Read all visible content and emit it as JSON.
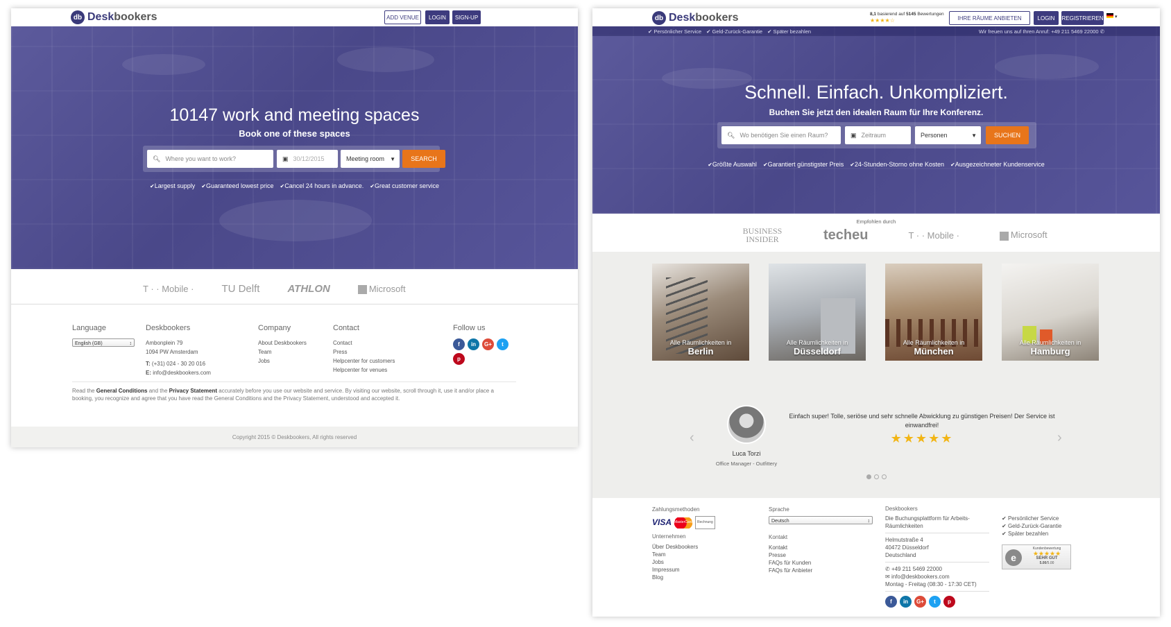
{
  "left": {
    "logo": {
      "mark": "db",
      "desk": "Desk",
      "bookers": "bookers"
    },
    "nav": {
      "add_venue": "ADD VENUE",
      "login": "LOGIN",
      "signup": "SIGN-UP"
    },
    "hero": {
      "title": "10147 work and meeting spaces",
      "subtitle": "Book one of these spaces",
      "search": {
        "where_placeholder": "Where you want to work?",
        "date": "30/12/2015",
        "type": "Meeting room",
        "button": "SEARCH"
      },
      "usps": [
        "Largest supply",
        "Guaranteed lowest price",
        "Cancel 24 hours in advance.",
        "Great customer service"
      ]
    },
    "partners": [
      "T · · Mobile ·",
      "TU Delft",
      "ATHLON",
      "Microsoft"
    ],
    "footer": {
      "language": {
        "heading": "Language",
        "value": "English (GB)"
      },
      "company_info": {
        "heading": "Deskbookers",
        "address1": "Ambonplein 79",
        "address2": "1094 PW Amsterdam",
        "phone_label": "T:",
        "phone": "(+31) 024 - 30 20 016",
        "email_label": "E:",
        "email": "info@deskbookers.com"
      },
      "company": {
        "heading": "Company",
        "links": [
          "About Deskbookers",
          "Team",
          "Jobs"
        ]
      },
      "contact": {
        "heading": "Contact",
        "links": [
          "Contact",
          "Press",
          "Helpcenter for customers",
          "Helpcenter for venues"
        ]
      },
      "follow": {
        "heading": "Follow us"
      },
      "legal": {
        "pre": "Read the ",
        "gc": "General Conditions",
        "mid": " and the ",
        "ps": "Privacy Statement",
        "post": " accurately before you use our website and service. By visiting our website, scroll through it, use it and/or place a booking, you recognize and agree that you have read the General Conditions and the Privacy Statement, understood and accepted it."
      },
      "copyright": "Copyright 2015 © Deskbookers, All rights reserved"
    }
  },
  "right": {
    "logo": {
      "mark": "db",
      "desk": "Desk",
      "bookers": "bookers"
    },
    "rating": {
      "score": "8,1",
      "pre": " basierend auf ",
      "count": "5145",
      "post": " Bewertungen",
      "stars": "★★★★☆"
    },
    "nav": {
      "offer": "IHRE RÄUME ANBIETEN",
      "login": "LOGIN",
      "register": "REGISTRIEREN"
    },
    "topbar": {
      "items": [
        "Persönlicher Service",
        "Geld-Zurück-Garantie",
        "Später bezahlen"
      ],
      "call": "Wir freuen uns auf Ihren Anruf: +49 211 5469 22000"
    },
    "hero": {
      "title": "Schnell. Einfach. Unkompliziert.",
      "subtitle": "Buchen Sie jetzt den idealen Raum für Ihre Konferenz.",
      "search": {
        "where_placeholder": "Wo benötigen Sie einen Raum?",
        "date_placeholder": "Zeitraum",
        "persons": "Personen",
        "button": "SUCHEN"
      },
      "usps": [
        "Größte Auswahl",
        "Garantiert günstigster Preis",
        "24-Stunden-Storno ohne Kosten",
        "Ausgezeichneter Kundenservice"
      ]
    },
    "recommended": {
      "label": "Empfohlen durch",
      "partners": [
        "BUSINESS INSIDER",
        "techeu",
        "T · · Mobile ·",
        "Microsoft"
      ]
    },
    "cities": [
      {
        "pre": "Alle Räumlichkeiten in",
        "name": "Berlin"
      },
      {
        "pre": "Alle Räumlichkeiten in",
        "name": "Düsseldorf"
      },
      {
        "pre": "Alle Räumlichkeiten in",
        "name": "München"
      },
      {
        "pre": "Alle Räumlichkeiten in",
        "name": "Hamburg"
      }
    ],
    "testimonial": {
      "quote": "Einfach super! Tolle, seriöse und sehr schnelle Abwicklung zu günstigen Preisen! Der Service ist einwandfrei!",
      "stars": "★★★★★",
      "name": "Luca Torzi",
      "role": "Office Manager - Outfittery"
    },
    "footer": {
      "payment": {
        "heading": "Zahlungsmethoden",
        "visa": "VISA",
        "mc": "MasterCard",
        "invoice": "Rechnung"
      },
      "company": {
        "heading": "Unternehmen",
        "links": [
          "Über Deskbookers",
          "Team",
          "Jobs",
          "Impressum",
          "Blog"
        ]
      },
      "language": {
        "heading": "Sprache",
        "value": "Deutsch"
      },
      "contact": {
        "heading": "Kontakt",
        "links": [
          "Kontakt",
          "Presse",
          "FAQs für Kunden",
          "FAQs für Anbieter"
        ]
      },
      "info": {
        "heading": "Deskbookers",
        "tagline": "Die Buchungsplattform für Arbeits- Räumlichkeiten",
        "street": "Helmutstraße 4",
        "city": "40472 Düsseldorf",
        "country": "Deutschland",
        "phone": "+49 211 5469 22000",
        "email": "info@deskbookers.com",
        "hours": "Montag - Freitag (08:30 - 17:30 CET)"
      },
      "usps": [
        "Persönlicher Service",
        "Geld-Zurück-Garantie",
        "Später bezahlen"
      ],
      "badge": {
        "title": "Kundenbewertung",
        "stars": "★★★★★",
        "grade": "SEHR GUT",
        "score": "5.00",
        "max": "/5.00"
      }
    }
  },
  "colors": {
    "primary": "#3d3b7e",
    "accent": "#e8751a",
    "facebook": "#3b5998",
    "linkedin": "#0e76a8",
    "google": "#dd4b39",
    "twitter": "#1da1f2",
    "pinterest": "#bd081c"
  }
}
